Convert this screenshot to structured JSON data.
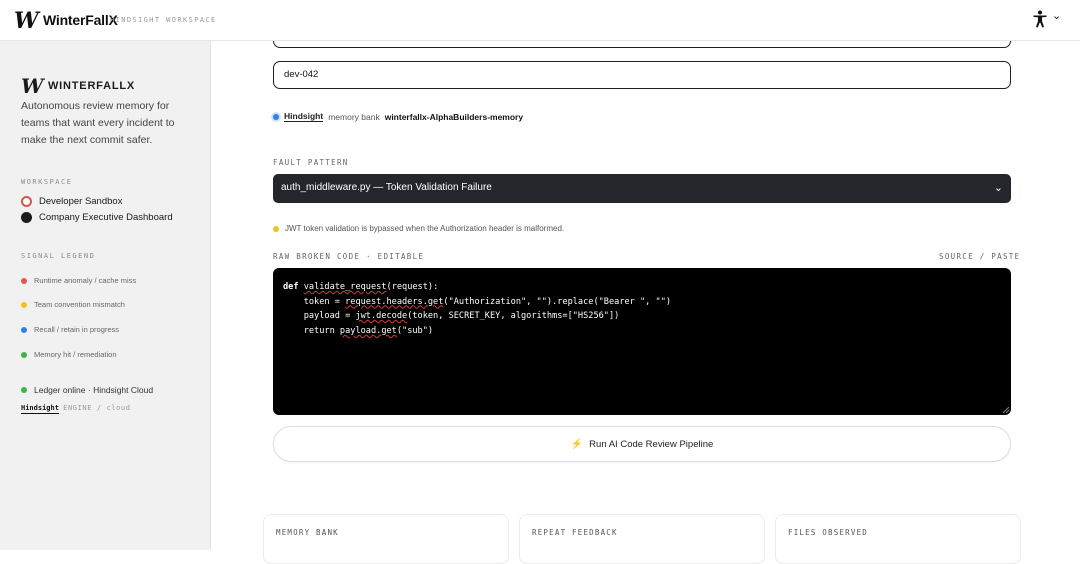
{
  "header": {
    "logo_glyph": "W",
    "brand": "WinterFallX",
    "subtitle": "HINDSIGHT WORKSPACE",
    "accessibility_icon": "accessibility-icon",
    "caret": "⌄"
  },
  "sidebar": {
    "logo_glyph": "W",
    "brand": "WINTERFALLX",
    "description": "Autonomous review memory for teams that want every incident to make the next commit safer.",
    "workspace_title": "WORKSPACE",
    "workspaces": [
      {
        "label": "Developer Sandbox",
        "color": "#d9534f"
      },
      {
        "label": "Company Executive Dashboard",
        "color": "#1d1d1d"
      }
    ],
    "legend_title": "SIGNAL LEGEND",
    "legend": [
      {
        "label": "Runtime anomaly / cache miss",
        "color": "#e05a4e"
      },
      {
        "label": "Team convention mismatch",
        "color": "#f0c419"
      },
      {
        "label": "Recall / retain in progress",
        "color": "#2f80ed"
      },
      {
        "label": "Memory hit / remediation",
        "color": "#3cb54a"
      }
    ],
    "ledger": {
      "label": "Ledger online · Hindsight Cloud",
      "color": "#3cb54a"
    },
    "engine": {
      "name": "Hindsight",
      "rest": "ENGINE / cloud"
    }
  },
  "main": {
    "dev_id_value": "dev-042",
    "memory_line": {
      "name": "Hindsight",
      "text": "memory bank",
      "bank": "winterfallx-AlphaBuilders-memory",
      "color": "#2f80ed"
    },
    "fault_label": "FAULT PATTERN",
    "fault_selected": "auth_middleware.py — Token Validation Failure",
    "warning": {
      "text": "JWT token validation is bypassed when the Authorization header is malformed.",
      "color": "#f0c419"
    },
    "code_label": "RAW BROKEN CODE · EDITABLE",
    "source_label": "SOURCE / PASTE",
    "code_lines": {
      "l1_kw": "def",
      "l1_fn": "validate_request",
      "l1_rest": "(request):",
      "l2_a": "    token = ",
      "l2_sq": "request.headers.get",
      "l2_b": "(\"Authorization\", \"\").replace(\"Bearer \", \"\")",
      "l3_a": "    payload = ",
      "l3_sq": "jwt.decode",
      "l3_b": "(token, SECRET_KEY, algorithms=[\"HS256\"])",
      "l4_a": "    return ",
      "l4_sq": "payload.get",
      "l4_b": "(\"sub\")"
    },
    "run_button": "Run AI Code Review Pipeline",
    "cards": [
      "MEMORY BANK",
      "REPEAT FEEDBACK",
      "FILES OBSERVED"
    ]
  }
}
